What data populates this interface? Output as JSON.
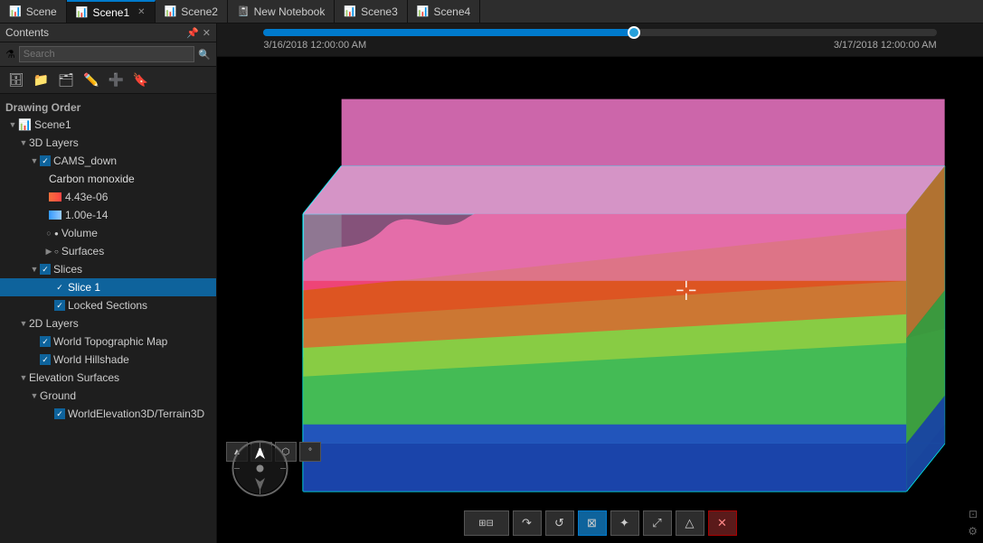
{
  "tabs": [
    {
      "id": "scene",
      "label": "Scene",
      "icon": "📊",
      "active": false,
      "closeable": false
    },
    {
      "id": "scene1",
      "label": "Scene1",
      "icon": "📊",
      "active": true,
      "closeable": true
    },
    {
      "id": "scene2",
      "label": "Scene2",
      "icon": "📊",
      "active": false,
      "closeable": false
    },
    {
      "id": "new_notebook",
      "label": "New Notebook",
      "icon": "📓",
      "active": false,
      "closeable": false
    },
    {
      "id": "scene3",
      "label": "Scene3",
      "icon": "📊",
      "active": false,
      "closeable": false
    },
    {
      "id": "scene4",
      "label": "Scene4",
      "icon": "📊",
      "active": false,
      "closeable": false
    }
  ],
  "sidebar": {
    "title": "Contents",
    "search_placeholder": "Search",
    "drawing_order_label": "Drawing Order",
    "tree": [
      {
        "id": "scene1_root",
        "label": "Scene1",
        "icon": "scene",
        "level": 0,
        "expanded": true,
        "type": "root"
      },
      {
        "id": "3d_layers",
        "label": "3D Layers",
        "level": 1,
        "expanded": true,
        "type": "group"
      },
      {
        "id": "cams_down",
        "label": "CAMS_down",
        "level": 2,
        "expanded": true,
        "checked": true,
        "type": "layer"
      },
      {
        "id": "carbon_mono",
        "label": "Carbon monoxide",
        "level": 3,
        "type": "sublabel",
        "color": "#f5703c"
      },
      {
        "id": "value1",
        "label": "4.43e-06",
        "level": 3,
        "type": "value"
      },
      {
        "id": "value2",
        "label": "1.00e-14",
        "level": 3,
        "type": "value"
      },
      {
        "id": "volume",
        "label": "Volume",
        "level": 3,
        "type": "item",
        "bullet": true
      },
      {
        "id": "surfaces",
        "label": "Surfaces",
        "level": 3,
        "type": "item",
        "circle": true
      },
      {
        "id": "slices",
        "label": "Slices",
        "level": 2,
        "expanded": true,
        "checked": true,
        "type": "layer"
      },
      {
        "id": "slice1",
        "label": "Slice 1",
        "level": 3,
        "checked": true,
        "type": "layer",
        "selected": true
      },
      {
        "id": "locked_sections",
        "label": "Locked Sections",
        "level": 3,
        "checked": true,
        "type": "layer"
      },
      {
        "id": "2d_layers",
        "label": "2D Layers",
        "level": 1,
        "expanded": true,
        "type": "group"
      },
      {
        "id": "world_topo",
        "label": "World Topographic Map",
        "level": 2,
        "checked": true,
        "type": "layer"
      },
      {
        "id": "world_hillshade",
        "label": "World Hillshade",
        "level": 2,
        "checked": true,
        "type": "layer"
      },
      {
        "id": "elevation_surfaces",
        "label": "Elevation Surfaces",
        "level": 1,
        "expanded": true,
        "type": "group"
      },
      {
        "id": "ground",
        "label": "Ground",
        "level": 2,
        "expanded": true,
        "type": "group"
      },
      {
        "id": "world_elevation",
        "label": "WorldElevation3D/Terrain3D",
        "level": 3,
        "checked": true,
        "type": "layer"
      }
    ]
  },
  "timeline": {
    "date_start": "3/16/2018 12:00:00 AM",
    "date_end": "3/17/12:00:00 AM",
    "date_end_full": "3/17/2018 12:00:00 AM",
    "fill_percent": 55
  },
  "toolbar_icons": [
    "⬜",
    "⬛",
    "🗂️",
    "✏️",
    "➕",
    "🔖"
  ],
  "nav_btns": [
    {
      "label": "⬜",
      "title": "nav1"
    },
    {
      "label": "↻",
      "title": "nav2"
    },
    {
      "label": "✦",
      "title": "nav3"
    }
  ],
  "scene_btns": [
    {
      "label": "⊞",
      "name": "select-tool",
      "active": false
    },
    {
      "label": "↷",
      "name": "rotate-tool",
      "active": false
    },
    {
      "label": "↺",
      "name": "orbit-tool",
      "active": false
    },
    {
      "label": "⊠",
      "name": "grid-tool",
      "active": true
    },
    {
      "label": "↔",
      "name": "pan-tool",
      "active": false
    },
    {
      "label": "⤢",
      "name": "navigate-tool",
      "active": false
    },
    {
      "label": "△",
      "name": "extrude-tool",
      "active": false
    },
    {
      "label": "✕",
      "name": "close-tool",
      "active": false,
      "style": "red"
    }
  ],
  "colors": {
    "accent": "#007acc",
    "selected": "#0e639c",
    "background": "#1e1e1e",
    "sidebar_bg": "#1e1e1e",
    "tab_bar_bg": "#2d2d2d",
    "scene_bg": "#000000"
  }
}
